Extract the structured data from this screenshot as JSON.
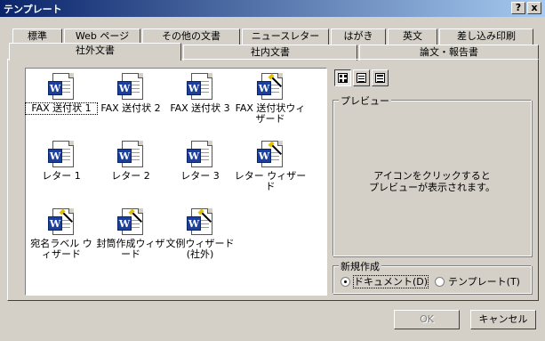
{
  "window": {
    "title": "テンプレート",
    "help_glyph": "?",
    "close_glyph": "x"
  },
  "tabs_back": [
    "標準",
    "Web ページ",
    "その他の文書",
    "ニュースレター",
    "はがき",
    "英文",
    "差し込み印刷"
  ],
  "tabs_front": [
    "社外文書",
    "社内文書",
    "論文・報告書"
  ],
  "active_tab": "社外文書",
  "items": [
    {
      "label": "FAX 送付状 1",
      "icon": "word-document-icon",
      "selected": true
    },
    {
      "label": "FAX 送付状 2",
      "icon": "word-document-icon"
    },
    {
      "label": "FAX 送付状 3",
      "icon": "word-document-icon"
    },
    {
      "label": "FAX 送付状ウィザード",
      "icon": "word-wizard-icon"
    },
    {
      "label": "レター 1",
      "icon": "word-document-icon"
    },
    {
      "label": "レター 2",
      "icon": "word-document-icon"
    },
    {
      "label": "レター 3",
      "icon": "word-document-icon"
    },
    {
      "label": "レター ウィザード",
      "icon": "word-wizard-icon"
    },
    {
      "label": "宛名ラベル ウィザード",
      "icon": "word-wizard-icon"
    },
    {
      "label": "封筒作成ウィザード",
      "icon": "word-wizard-icon"
    },
    {
      "label": "文例ウィザード (社外)",
      "icon": "word-wizard-icon"
    }
  ],
  "view_buttons": [
    "large-icons-view-icon",
    "list-view-icon",
    "details-view-icon"
  ],
  "preview": {
    "legend": "プレビュー",
    "text_line1": "アイコンをクリックすると",
    "text_line2": "プレビューが表示されます。"
  },
  "create_new": {
    "legend": "新規作成",
    "document": "ドキュメント(D)",
    "template": "テンプレート(T)",
    "selected": "document"
  },
  "buttons": {
    "ok": "OK",
    "cancel": "キャンセル"
  }
}
